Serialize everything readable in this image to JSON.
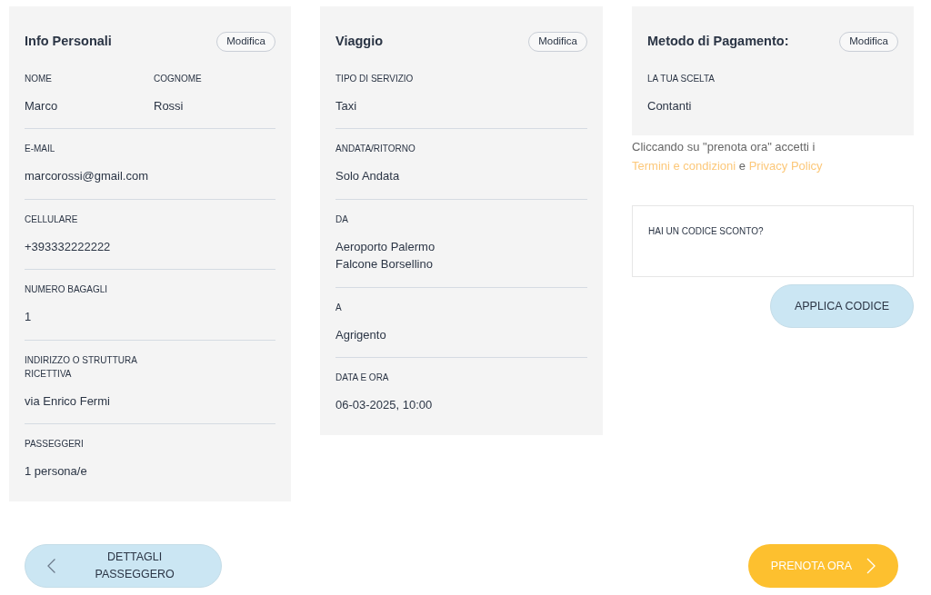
{
  "cards": [
    {
      "title": "Info Personali",
      "edit_button": "Modifica",
      "rows": [
        [
          {
            "label": "NOME",
            "value": "Marco"
          },
          {
            "label": "COGNOME",
            "value": "Rossi"
          }
        ],
        [
          {
            "label": "E-MAIL",
            "value": "marcorossi@gmail.com"
          }
        ],
        [
          {
            "label": "CELLULARE",
            "value": "+393332222222"
          }
        ],
        [
          {
            "label": "NUMERO BAGAGLI",
            "value": "1"
          }
        ],
        [
          {
            "label": "INDIRIZZO O STRUTTURA RICETTIVA",
            "value": "via Enrico Fermi"
          }
        ],
        [
          {
            "label": "PASSEGGERI",
            "value": "1 persona/e"
          }
        ]
      ]
    },
    {
      "title": "Viaggio",
      "edit_button": "Modifica",
      "rows": [
        [
          {
            "label": "TIPO DI SERVIZIO",
            "value": "Taxi"
          }
        ],
        [
          {
            "label": "ANDATA/RITORNO",
            "value": "Solo Andata"
          }
        ],
        [
          {
            "label": "DA",
            "value": "Aeroporto Palermo Falcone Borsellino"
          }
        ],
        [
          {
            "label": "A",
            "value": "Agrigento"
          }
        ],
        [
          {
            "label": "DATA E ORA",
            "value": "06-03-2025, 10:00"
          }
        ]
      ]
    },
    {
      "title": "Metodo di Pagamento:",
      "edit_button": "Modifica",
      "rows": [
        [
          {
            "label": "LA TUA SCELTA",
            "value": "Contanti"
          }
        ]
      ]
    }
  ],
  "terms": [
    {
      "kind": "text",
      "text": "Cliccando su \"prenota ora\" accetti i"
    },
    {
      "kind": "link",
      "text": "Termini e condizioni"
    },
    {
      "kind": "text",
      "text": "e"
    },
    {
      "kind": "link",
      "text": "Privacy Policy"
    }
  ],
  "discount": {
    "placeholder": "HAI UN CODICE SCONTO?",
    "button": "APPLICA CODICE"
  },
  "back_button": "DETTAGLI PASSEGGERO",
  "book_button": "PRENOTA ORA"
}
